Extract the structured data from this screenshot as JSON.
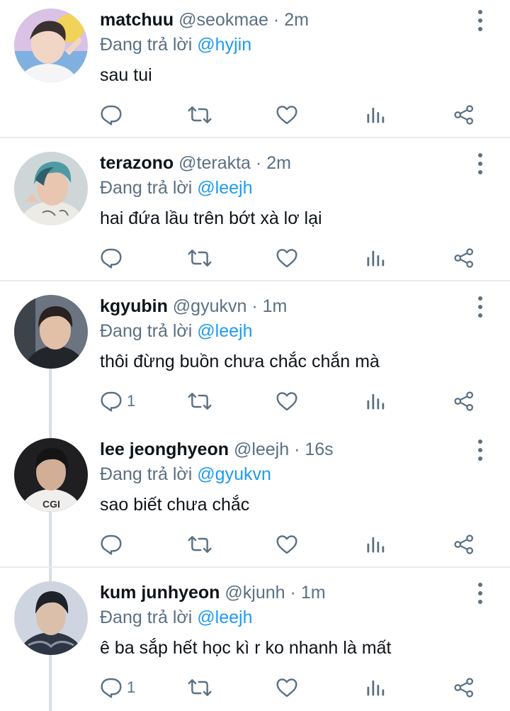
{
  "tweets": [
    {
      "name": "matchuu",
      "handle": "@seokmae",
      "separator": "·",
      "time": "2m",
      "replying_prefix": "Đang trả lời",
      "replying_to": "@hyjin",
      "text": "sau tui",
      "reply_count": "",
      "avatar_colors": [
        "#c9a3d8",
        "#f2d35a",
        "#7fb0e0"
      ]
    },
    {
      "name": "terazono",
      "handle": "@terakta",
      "separator": "·",
      "time": "2m",
      "replying_prefix": "Đang trả lời",
      "replying_to": "@leejh",
      "text": "hai đứa lầu trên bớt xà lơ lại",
      "reply_count": "",
      "avatar_colors": [
        "#6fb3b8",
        "#2a4b5a",
        "#e8e4de"
      ]
    },
    {
      "name": "kgyubin",
      "handle": "@gyukvn",
      "separator": "·",
      "time": "1m",
      "replying_prefix": "Đang trả lời",
      "replying_to": "@leejh",
      "text": "thôi đừng buồn chưa chắc chắn mà",
      "reply_count": "1",
      "avatar_colors": [
        "#5a6470",
        "#2b2f35",
        "#d9b9a2"
      ]
    },
    {
      "name": "lee jeonghyeon",
      "handle": "@leejh",
      "separator": "·",
      "time": "16s",
      "replying_prefix": "Đang trả lời",
      "replying_to": "@gyukvn",
      "text": "sao biết chưa chắc",
      "reply_count": "",
      "avatar_colors": [
        "#1c1c1e",
        "#f0efee",
        "#caa189"
      ]
    },
    {
      "name": "kum junhyeon",
      "handle": "@kjunh",
      "separator": "·",
      "time": "1m",
      "replying_prefix": "Đang trả lời",
      "replying_to": "@leejh",
      "text": "ê ba sắp hết học kì r ko nhanh là mất",
      "reply_count": "1",
      "avatar_colors": [
        "#c8cfdc",
        "#2e3440",
        "#d8b9a5"
      ]
    }
  ],
  "icons": {
    "reply": "reply-icon",
    "retweet": "retweet-icon",
    "like": "like-icon",
    "analytics": "analytics-icon",
    "share": "share-icon",
    "more": "more-vertical-icon"
  },
  "colors": {
    "secondary_text": "#5b7083",
    "mention": "#1d9bf0",
    "primary_text": "#0f1419",
    "divider": "#e6ecf0"
  }
}
